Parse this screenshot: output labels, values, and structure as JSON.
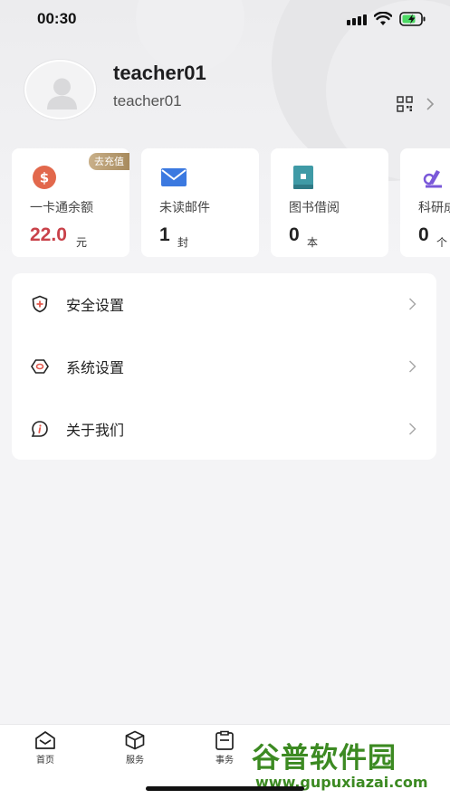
{
  "status_bar": {
    "time": "00:30"
  },
  "profile": {
    "username": "teacher01",
    "account_id": "teacher01"
  },
  "cards": [
    {
      "label": "一卡通余额",
      "value": "22.0",
      "unit": "元",
      "badge": "去充值",
      "icon": "dollar-coin-icon",
      "value_color": "#c9424a"
    },
    {
      "label": "未读邮件",
      "value": "1",
      "unit": "封",
      "icon": "envelope-icon"
    },
    {
      "label": "图书借阅",
      "value": "0",
      "unit": "本",
      "icon": "book-icon"
    },
    {
      "label": "科研成",
      "value": "0",
      "unit": "个",
      "icon": "microscope-icon"
    }
  ],
  "settings": [
    {
      "label": "安全设置",
      "icon": "shield-icon"
    },
    {
      "label": "系统设置",
      "icon": "hexagon-gear-icon"
    },
    {
      "label": "关于我们",
      "icon": "info-bubble-icon"
    }
  ],
  "tabs": [
    {
      "label": "首页",
      "icon": "home-mail-icon"
    },
    {
      "label": "服务",
      "icon": "cube-icon"
    },
    {
      "label": "事务",
      "icon": "clipboard-icon"
    }
  ],
  "watermark": {
    "title": "谷普软件园",
    "url": "www.gupuxiazai.com"
  },
  "colors": {
    "accent_red": "#c9424a",
    "badge_gold": "#b79a6b",
    "watermark_green": "#3c8a22"
  }
}
